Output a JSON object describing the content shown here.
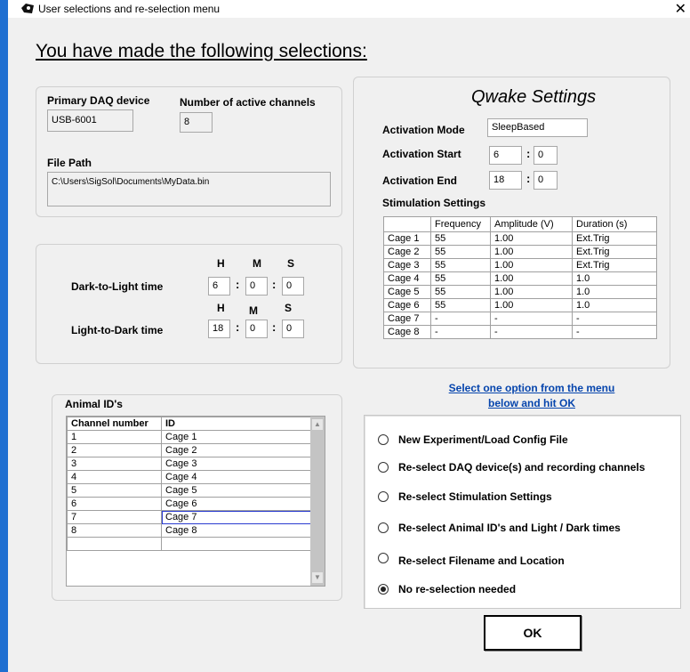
{
  "window": {
    "title": "User selections and re-selection menu",
    "close_glyph": "✕"
  },
  "heading": "You have made the following selections:",
  "daq": {
    "primary_label": "Primary DAQ device",
    "primary_value": "USB-6001",
    "channels_label": "Number of active channels",
    "channels_value": "8",
    "file_path_label": "File Path",
    "file_path_value": "C:\\Users\\SigSol\\Documents\\MyData.bin"
  },
  "light": {
    "h": "H",
    "m": "M",
    "s": "S",
    "dark_to_light_label": "Dark-to-Light time",
    "dark_to_light": {
      "h": "6",
      "m": "0",
      "s": "0"
    },
    "light_to_dark_label": "Light-to-Dark time",
    "light_to_dark": {
      "h": "18",
      "m": "0",
      "s": "0"
    }
  },
  "animal": {
    "title": "Animal ID's",
    "columns": [
      "Channel number",
      "ID"
    ],
    "rows": [
      [
        "1",
        "Cage 1"
      ],
      [
        "2",
        "Cage 2"
      ],
      [
        "3",
        "Cage 3"
      ],
      [
        "4",
        "Cage 4"
      ],
      [
        "5",
        "Cage 5"
      ],
      [
        "6",
        "Cage 6"
      ],
      [
        "7",
        "Cage 7"
      ],
      [
        "8",
        "Cage 8"
      ]
    ]
  },
  "qwake": {
    "title": "Qwake Settings",
    "mode_label": "Activation Mode",
    "mode_value": "SleepBased",
    "start_label": "Activation Start",
    "start_h": "6",
    "start_m": "0",
    "end_label": "Activation End",
    "end_h": "18",
    "end_m": "0",
    "stim_label": "Stimulation Settings",
    "stim_columns": [
      "",
      "Frequency",
      "Amplitude (V)",
      "Duration (s)"
    ],
    "stim_rows": [
      [
        "Cage 1",
        "55",
        "1.00",
        "Ext.Trig"
      ],
      [
        "Cage 2",
        "55",
        "1.00",
        "Ext.Trig"
      ],
      [
        "Cage 3",
        "55",
        "1.00",
        "Ext.Trig"
      ],
      [
        "Cage 4",
        "55",
        "1.00",
        "1.0"
      ],
      [
        "Cage 5",
        "55",
        "1.00",
        "1.0"
      ],
      [
        "Cage 6",
        "55",
        "1.00",
        "1.0"
      ],
      [
        "Cage 7",
        "-",
        "-",
        "-"
      ],
      [
        "Cage 8",
        "-",
        "-",
        "-"
      ]
    ]
  },
  "menu": {
    "prompt_line1": "Select one option from the menu",
    "prompt_line2": "below and hit OK",
    "options": [
      "New Experiment/Load Config File",
      "Re-select DAQ device(s) and recording channels",
      "Re-select Stimulation Settings",
      "Re-select Animal ID's and Light / Dark times",
      "Re-select Filename and Location",
      "No re-selection needed"
    ],
    "selected_index": 5
  },
  "ok_label": "OK"
}
